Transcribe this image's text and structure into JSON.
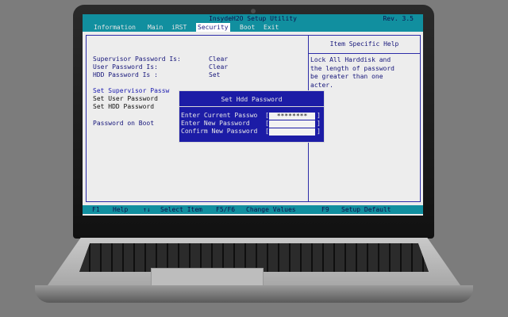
{
  "bios": {
    "title": "InsydeH2O Setup Utility",
    "version": "Rev. 3.5",
    "menu": [
      {
        "label": "Information",
        "active": false
      },
      {
        "label": "Main",
        "active": false
      },
      {
        "label": "iRST",
        "active": false
      },
      {
        "label": "Security",
        "active": true
      },
      {
        "label": "Boot",
        "active": false
      },
      {
        "label": "Exit",
        "active": false
      }
    ],
    "status_rows": [
      {
        "label": "Supervisor Password Is:",
        "value": "Clear"
      },
      {
        "label": "User Password Is:",
        "value": "Clear"
      },
      {
        "label": "HDD Password Is :",
        "value": "Set"
      }
    ],
    "options": [
      "Set Supervisor Passw",
      "Set User Password",
      "Set HDD Password"
    ],
    "hdd_on_boot_label": "Password on Boot",
    "help": {
      "header": "Item Specific Help",
      "lines": [
        "Lock All Harddisk and",
        "the length of password",
        "be greater than one",
        "acter."
      ]
    },
    "dialog": {
      "title": "Set Hdd Password",
      "fields": [
        {
          "label": "Enter Current Passwo",
          "value": "********"
        },
        {
          "label": "Enter New Password",
          "value": ""
        },
        {
          "label": "Confirm New Password",
          "value": ""
        }
      ]
    },
    "footer": {
      "f1": "F1",
      "help": "Help",
      "arrows": "↑↓",
      "select_item": "Select Item",
      "f5f6": "F5/F6",
      "change_values": "Change Values",
      "f9": "F9",
      "setup_default": "Setup Default"
    }
  }
}
